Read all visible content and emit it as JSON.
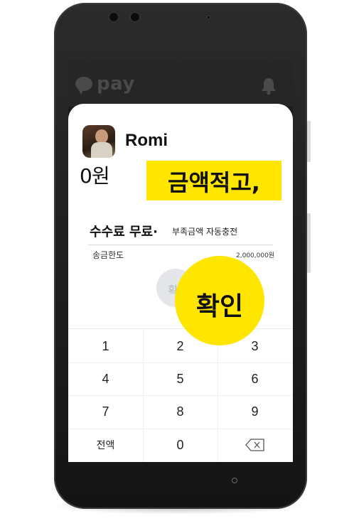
{
  "header": {
    "app_name": "pay",
    "bell_icon": "bell-icon",
    "logo_icon": "chat-bubble-icon"
  },
  "recipient": {
    "name": "Romi"
  },
  "amount": {
    "value": "0원",
    "callout": "금액적고,"
  },
  "fee": {
    "label": "수수료 무료·",
    "sub": "부족금액 자동충전"
  },
  "limit": {
    "label": "송금한도",
    "value": "2,000,000원"
  },
  "confirm": {
    "ghost_label": "확",
    "label": "확인"
  },
  "keypad": {
    "keys": [
      "1",
      "2",
      "3",
      "4",
      "5",
      "6",
      "7",
      "8",
      "9",
      "전액",
      "0"
    ],
    "backspace_icon": "backspace-icon"
  },
  "colors": {
    "accent": "#ffe600",
    "phone_body": "#1a1a1a",
    "topbar": "#262626"
  }
}
